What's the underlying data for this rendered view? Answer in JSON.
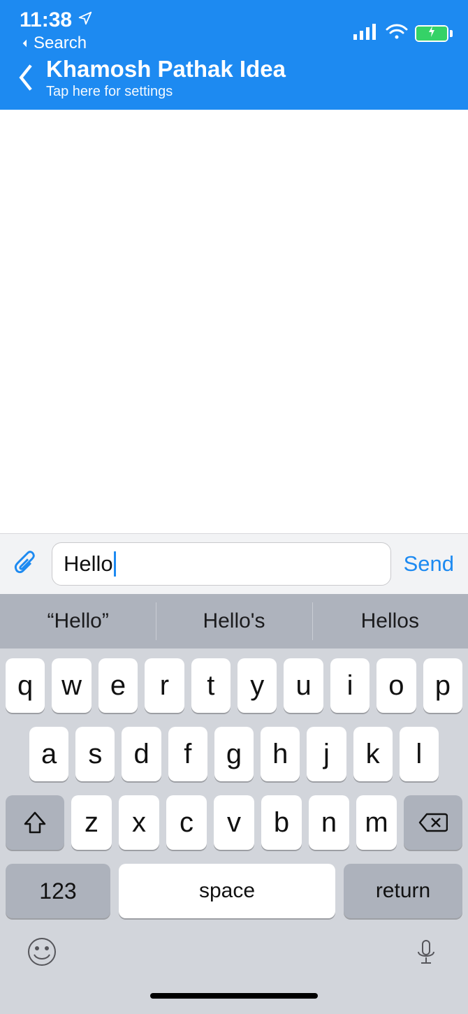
{
  "statusbar": {
    "time": "11:38",
    "back_app_label": "Search"
  },
  "header": {
    "title": "Khamosh Pathak Idea",
    "subtitle": "Tap here for settings"
  },
  "compose": {
    "attach_icon": "paperclip-icon",
    "input_value": "Hello",
    "send_label": "Send"
  },
  "suggestions": [
    "“Hello”",
    "Hello's",
    "Hellos"
  ],
  "keyboard": {
    "row1": [
      "q",
      "w",
      "e",
      "r",
      "t",
      "y",
      "u",
      "i",
      "o",
      "p"
    ],
    "row2": [
      "a",
      "s",
      "d",
      "f",
      "g",
      "h",
      "j",
      "k",
      "l"
    ],
    "row3": [
      "z",
      "x",
      "c",
      "v",
      "b",
      "n",
      "m"
    ],
    "numbers_label": "123",
    "space_label": "space",
    "return_label": "return"
  }
}
